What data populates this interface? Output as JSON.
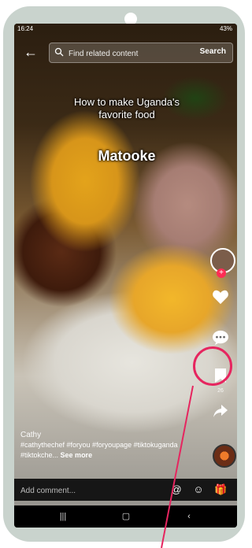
{
  "status_bar": {
    "time": "16:24",
    "right": "43%"
  },
  "search": {
    "placeholder": "Find related content",
    "button_label": "Search"
  },
  "overlay": {
    "title_line": "How to make Uganda's favorite food",
    "dish_name": "Matooke"
  },
  "actions": {
    "like_count": "",
    "comment_count": "",
    "save_count": "26",
    "share_count": ""
  },
  "caption": {
    "username": "Cathy",
    "text": "#cathythechef #foryou #foryoupage #tiktokuganda #tiktokche...",
    "see_more": "See more"
  },
  "comment_bar": {
    "placeholder": "Add comment..."
  },
  "colors": {
    "highlight": "#e6255f",
    "follow_plus": "#fe2c55",
    "frame": "#c9d3cd"
  },
  "icons": [
    "back-icon",
    "search-icon",
    "heart-icon",
    "comment-icon",
    "bookmark-icon",
    "share-icon",
    "at-icon",
    "emoji-icon",
    "gift-icon",
    "recents-icon",
    "home-icon",
    "back-nav-icon"
  ]
}
